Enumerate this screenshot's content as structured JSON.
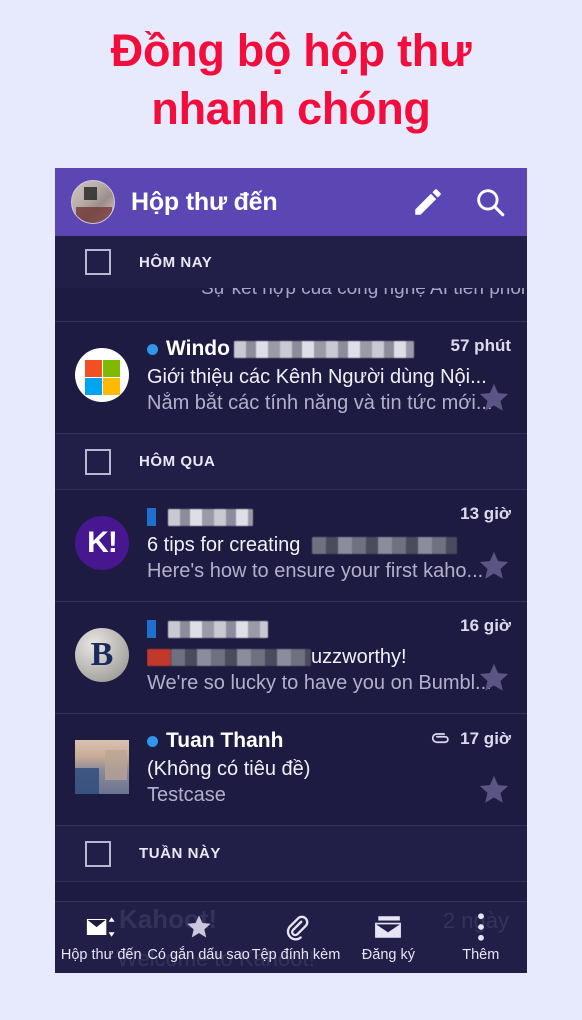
{
  "headline": {
    "line1": "Đồng bộ hộp thư",
    "line2": "nhanh chóng"
  },
  "colors": {
    "page_background": "#e6eafc",
    "headline": "#f20d3c",
    "appbar": "#5b46b4",
    "list_background": "#1e1b42",
    "section_background": "#211e47",
    "unread_dot": "#2f96e8",
    "star": "#5a5585",
    "kahoot_purple": "#46178f"
  },
  "appbar": {
    "title": "Hộp thư đến",
    "avatar_icon": "user-avatar",
    "compose_icon": "pencil-icon",
    "search_icon": "search-icon"
  },
  "sections": {
    "today": "HÔM NAY",
    "yesterday": "HÔM QUA",
    "this_week": "TUẦN NÀY"
  },
  "ghost_row": {
    "text": "Sự kết hợp của công nghệ AI tiên phong ..."
  },
  "messages": [
    {
      "avatar_icon": "microsoft-logo",
      "sender": "Windo",
      "sender_blurred": true,
      "unread": true,
      "time": "57 phút",
      "subject": "Giới thiệu các Kênh Người dùng Nội...",
      "preview": "Nắm bắt các tính năng và tin tức mới...",
      "has_attachment": false,
      "star_icon": "star-icon"
    },
    {
      "avatar_icon": "kahoot-logo",
      "avatar_text": "K!",
      "sender": "",
      "sender_blurred": true,
      "unread": true,
      "time": "13 giờ",
      "subject": "6 tips for creating",
      "subject_blurred_suffix": true,
      "preview": "Here's how to ensure your first kaho...",
      "has_attachment": false,
      "star_icon": "star-icon"
    },
    {
      "avatar_icon": "bumble-logo",
      "avatar_text": "B",
      "sender": "",
      "sender_blurred": true,
      "unread": true,
      "time": "16 giờ",
      "subject": "uzzworthy!",
      "subject_blurred_prefix": true,
      "preview": "We're so lucky to have you on Bumbl...",
      "has_attachment": false,
      "star_icon": "star-icon"
    },
    {
      "avatar_icon": "contact-photo",
      "sender": "Tuan Thanh",
      "sender_blurred": false,
      "unread": true,
      "time": "17 giờ",
      "subject": "(Không có tiêu đề)",
      "preview": "Testcase",
      "has_attachment": true,
      "attachment_icon": "paperclip-icon",
      "star_icon": "star-icon"
    }
  ],
  "watermark": {
    "brand": "Kahoot!",
    "tagline": "Welcome to Kahoot!",
    "age": "2 ngày"
  },
  "bottom_nav": [
    {
      "label": "Hộp thư đến",
      "icon": "inbox-envelope-icon",
      "active": true
    },
    {
      "label": "Có gắn dấu sao",
      "icon": "star-icon",
      "active": false
    },
    {
      "label": "Tệp đính kèm",
      "icon": "paperclip-icon",
      "active": false
    },
    {
      "label": "Đăng ký",
      "icon": "subscriptions-icon",
      "active": false
    },
    {
      "label": "Thêm",
      "icon": "more-dots-icon",
      "active": false
    }
  ]
}
